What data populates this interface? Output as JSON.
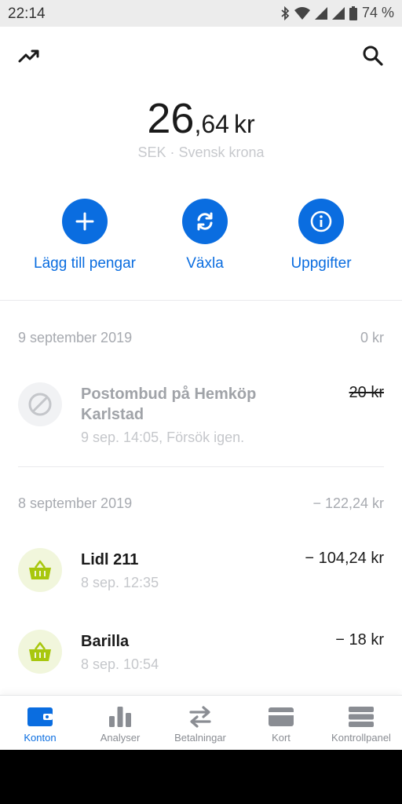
{
  "status_bar": {
    "time": "22:14",
    "battery": "74 %",
    "icons": [
      "bluetooth-icon",
      "wifi-icon",
      "signal-icon",
      "signal-icon",
      "battery-icon"
    ]
  },
  "header": {
    "left_icon": "trending-up-icon",
    "right_icon": "search-icon"
  },
  "balance": {
    "integer": "26",
    "decimal": ",64",
    "currency": "kr",
    "subtitle": "SEK · Svensk krona"
  },
  "actions": [
    {
      "label": "Lägg till pengar",
      "icon": "plus-icon"
    },
    {
      "label": "Växla",
      "icon": "exchange-icon"
    },
    {
      "label": "Uppgifter",
      "icon": "info-icon"
    }
  ],
  "groups": [
    {
      "date": "9 september 2019",
      "total": "0 kr",
      "transactions": [
        {
          "title_line1": "Postombud på Hemköp",
          "title_line2": "Karlstad",
          "meta": "9 sep. 14:05, Försök igen.",
          "amount": "20 kr",
          "status": "failed",
          "icon": "blocked-icon"
        }
      ]
    },
    {
      "date": "8 september 2019",
      "total": "− 122,24 kr",
      "transactions": [
        {
          "title": "Lidl 211",
          "meta": "8 sep. 12:35",
          "amount": "− 104,24 kr",
          "icon": "shopping-basket-icon"
        },
        {
          "title": "Barilla",
          "meta": "8 sep. 10:54",
          "amount": "− 18 kr",
          "icon": "shopping-basket-icon"
        }
      ]
    }
  ],
  "bottom_nav": [
    {
      "label": "Konton",
      "icon": "wallet-icon",
      "active": true
    },
    {
      "label": "Analyser",
      "icon": "bar-chart-icon",
      "active": false
    },
    {
      "label": "Betalningar",
      "icon": "transfer-arrows-icon",
      "active": false
    },
    {
      "label": "Kort",
      "icon": "card-icon",
      "active": false
    },
    {
      "label": "Kontrollpanel",
      "icon": "stack-icon",
      "active": false
    }
  ],
  "colors": {
    "accent": "#0a6de0",
    "basket_bg": "#f1f6dc",
    "basket_icon": "#a8c70e"
  }
}
